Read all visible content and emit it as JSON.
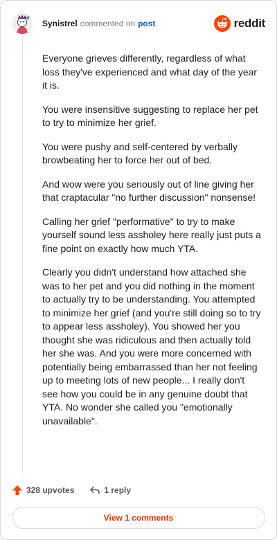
{
  "header": {
    "username": "Synistrel",
    "action": "commented on",
    "post_link": "post",
    "logo_text": "reddit"
  },
  "comment": {
    "paragraphs": [
      "Everyone grieves differently, regardless of what loss they've experienced and what day of the year it is.",
      "You were insensitive suggesting to replace her pet to try to minimize her grief.",
      "You were pushy and self-centered by verbally browbeating her to force her out of bed.",
      "And wow were you seriously out of line giving her that craptacular \"no further discussion\" nonsense!",
      "Calling her grief \"performative\" to try to make yourself sound less assholey here really just puts a fine point on exactly how much YTA.",
      "Clearly you didn't understand how attached she was to her pet and you did nothing in the moment to actually try to be understanding. You attempted to minimize her grief (and you're still doing so to try to appear less assholey). You showed her you thought she was ridiculous and then actually told her she was. And you were more concerned with potentially being embarrassed than her not feeling up to meeting lots of new people... I really don't see how you could be in any genuine doubt that YTA. No wonder she called you \"emotionally unavailable\"."
    ]
  },
  "footer": {
    "upvotes": "328 upvotes",
    "replies": "1 reply",
    "view_comments": "View 1 comments"
  },
  "colors": {
    "accent": "#ff4500",
    "link": "#0a5fb4",
    "view_button_text": "#d93a00"
  },
  "icons": {
    "upvote": "arrow-up-icon",
    "reply": "reply-arrow-icon",
    "logo": "reddit-snoo-icon"
  }
}
